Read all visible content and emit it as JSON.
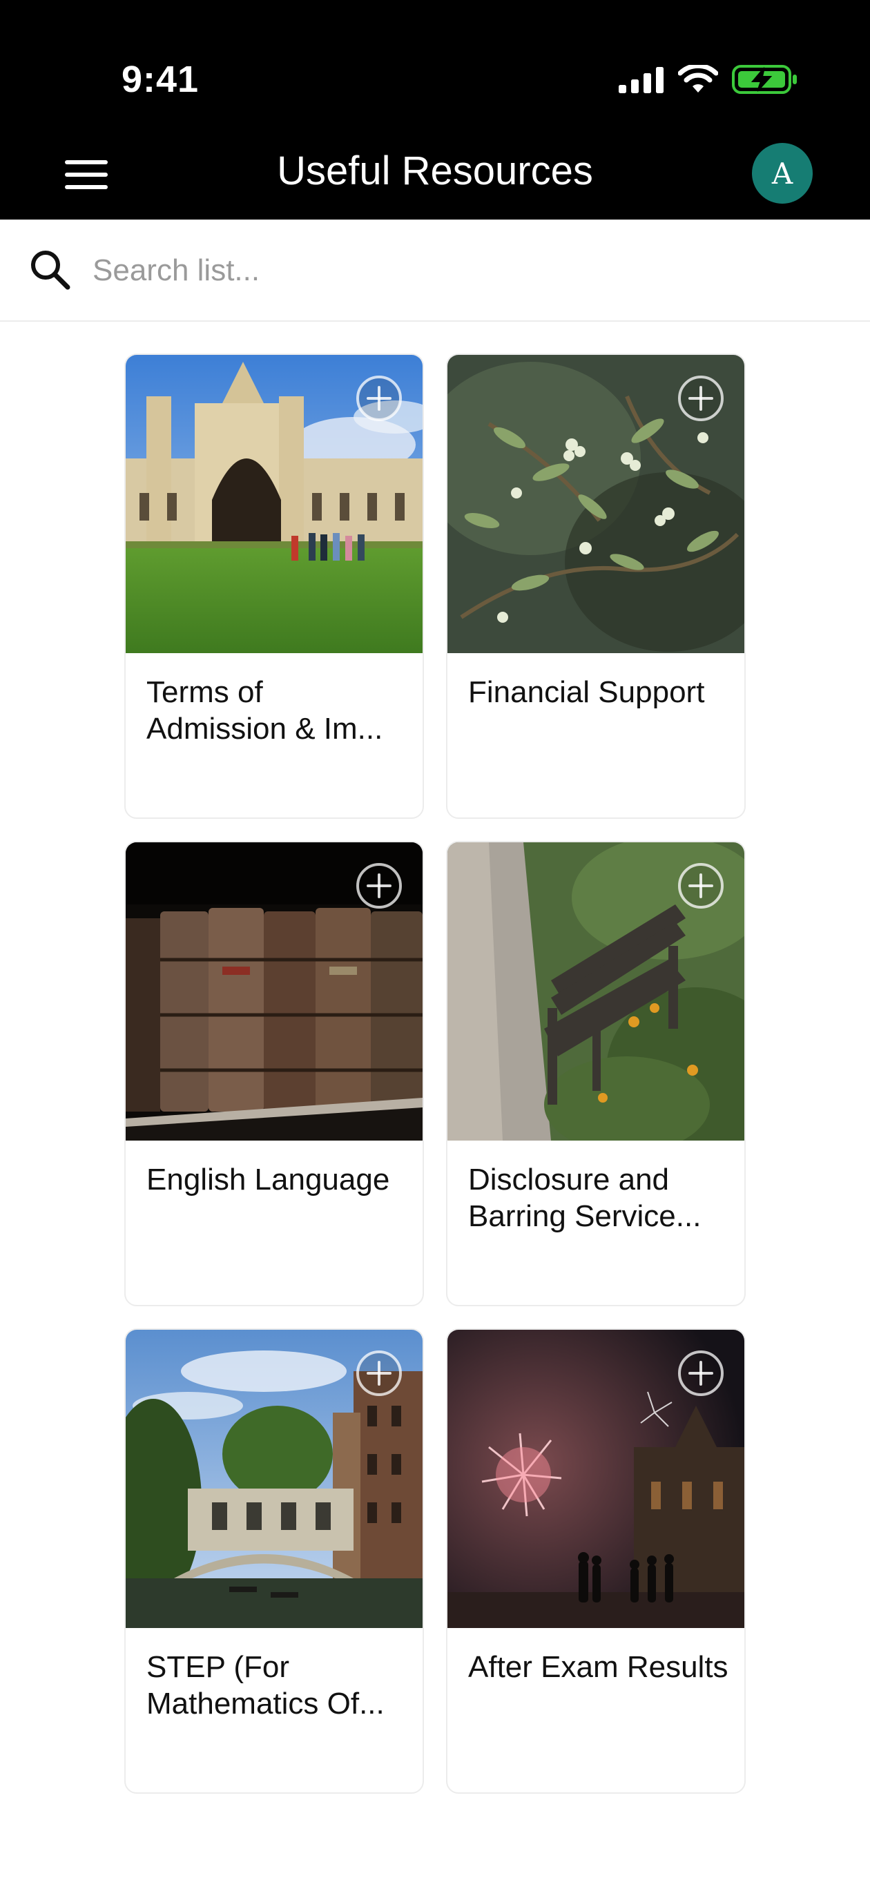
{
  "status_bar": {
    "time": "9:41"
  },
  "header": {
    "title": "Useful Resources",
    "avatar_initial": "A",
    "avatar_color": "#167d73"
  },
  "search": {
    "placeholder": "Search list..."
  },
  "cards": [
    {
      "title": "Terms of Admission & Im...",
      "image": "college-gatehouse"
    },
    {
      "title": "Financial Support",
      "image": "mistletoe-branches"
    },
    {
      "title": "English Language",
      "image": "old-book-spines"
    },
    {
      "title": "Disclosure and Barring Service...",
      "image": "garden-bench"
    },
    {
      "title": "STEP (For Mathematics Of...",
      "image": "bridge-over-river"
    },
    {
      "title": "After Exam Results",
      "image": "fireworks-night"
    }
  ],
  "icons": {
    "menu": "hamburger-icon",
    "search": "search-icon",
    "add": "plus-circle-icon",
    "signal": "signal-icon",
    "wifi": "wifi-icon",
    "battery": "battery-charging-icon"
  },
  "colors": {
    "header_bg": "#000000",
    "battery_green": "#3cc93b"
  }
}
